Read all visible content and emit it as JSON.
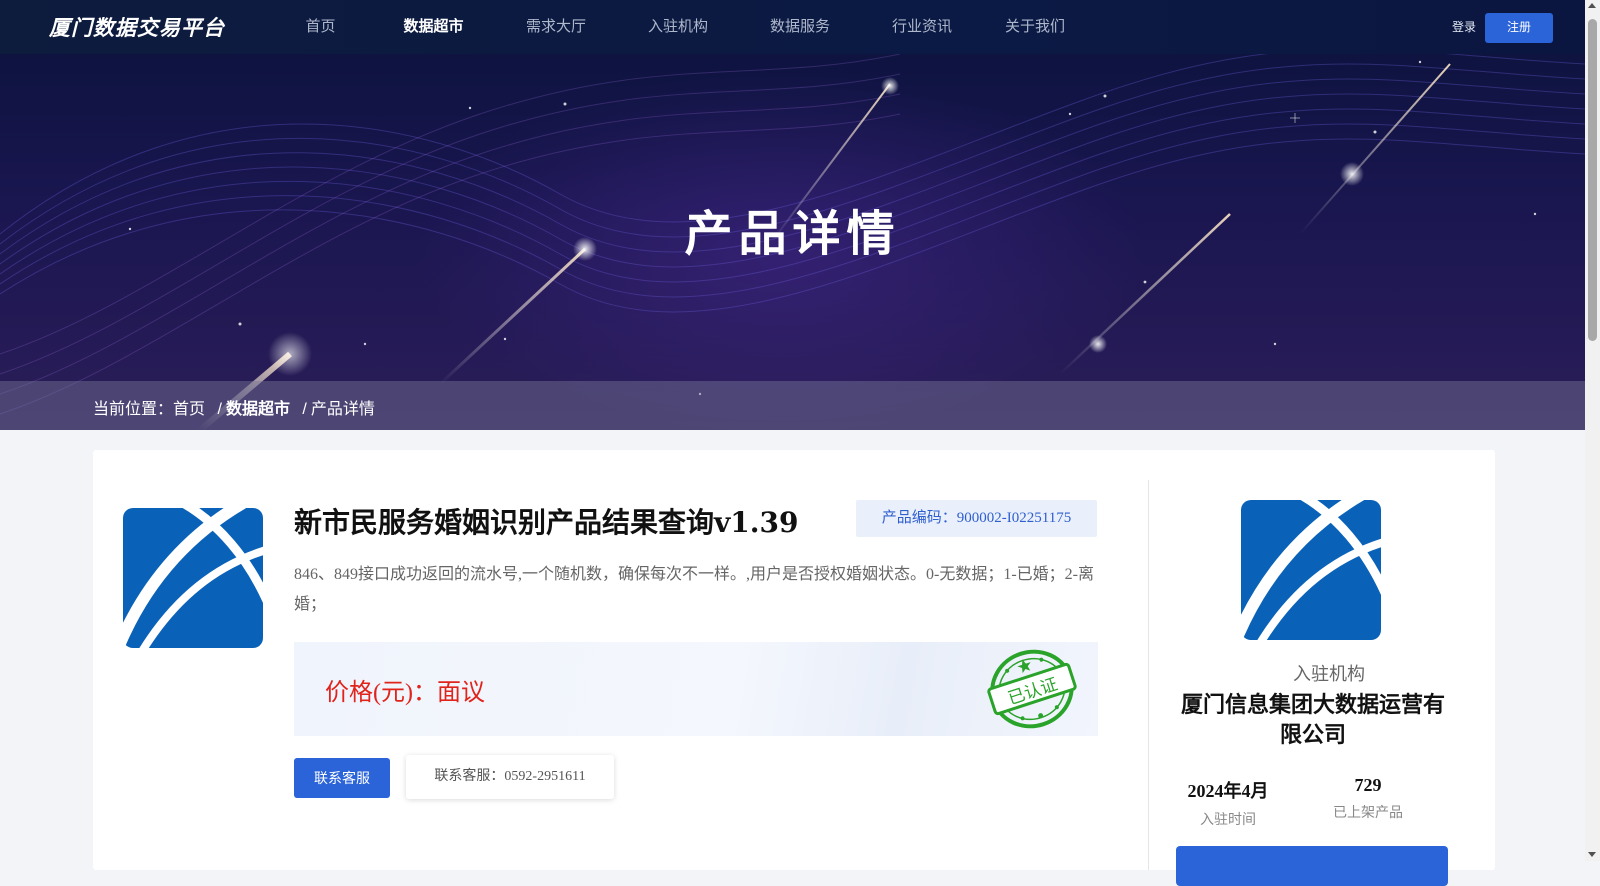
{
  "header": {
    "logo_text": "厦门数据交易平台",
    "nav": [
      {
        "label": "首页"
      },
      {
        "label": "数据超市"
      },
      {
        "label": "需求大厅"
      },
      {
        "label": "入驻机构"
      },
      {
        "label": "数据服务"
      },
      {
        "label": "行业资讯"
      },
      {
        "label": "关于我们"
      }
    ],
    "active_nav": "数据超市",
    "login_label": "登录",
    "register_label": "注册"
  },
  "banner": {
    "title": "产品详情"
  },
  "breadcrumb": {
    "prefix": "当前位置：",
    "items": [
      "首页",
      "数据超市",
      "产品详情"
    ],
    "separator": "/"
  },
  "product": {
    "title": "新市民服务婚姻识别产品结果查询v1.39",
    "code_label": "产品编码：900002-I02251175",
    "description": "846、849接口成功返回的流水号,一个随机数，确保每次不一样。,用户是否授权婚姻状态。0-无数据；1-已婚；2-离婚；",
    "price_label": "价格(元)：面议",
    "stamp_text": "已认证",
    "contact_button": "联系客服",
    "contact_tooltip": "联系客服：0592-2951611"
  },
  "organization": {
    "kicker": "入驻机构",
    "name": "厦门信息集团大数据运营有限公司",
    "stats": [
      {
        "value": "2024年4月",
        "label": "入驻时间"
      },
      {
        "value": "729",
        "label": "已上架产品"
      }
    ]
  },
  "colors": {
    "primary": "#2b63d9",
    "price": "#e0241b",
    "stamp": "#2aa32a",
    "header_bg": "#0d1b3d"
  },
  "icons": {
    "product_logo": "brand-arc-logo",
    "org_logo": "brand-arc-logo",
    "stamp": "certified-stamp"
  }
}
